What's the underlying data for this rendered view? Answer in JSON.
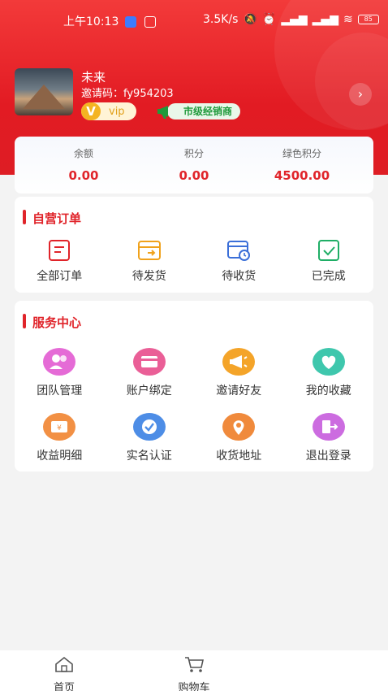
{
  "status_bar": {
    "time": "上午10:13",
    "network_speed": "3.5K/s",
    "battery": "85"
  },
  "profile": {
    "username": "未来",
    "invite_code": "邀请码：fy954203",
    "vip_label": "vip",
    "vip_letter": "V",
    "dealer_label": "市级经销商"
  },
  "balance": {
    "items": [
      {
        "label": "余额",
        "value": "0.00"
      },
      {
        "label": "积分",
        "value": "0.00"
      },
      {
        "label": "绿色积分",
        "value": "4500.00"
      }
    ]
  },
  "orders": {
    "title": "自营订单",
    "items": [
      {
        "label": "全部订单",
        "icon": "order-list-icon",
        "color": "#e0242a"
      },
      {
        "label": "待发货",
        "icon": "ship-pending-icon",
        "color": "#f0a21c"
      },
      {
        "label": "待收货",
        "icon": "receive-pending-icon",
        "color": "#3b6fd8"
      },
      {
        "label": "已完成",
        "icon": "completed-icon",
        "color": "#1fae66"
      }
    ]
  },
  "services": {
    "title": "服务中心",
    "items": [
      {
        "label": "团队管理",
        "icon": "team-icon",
        "color": "#e56bd6"
      },
      {
        "label": "账户绑定",
        "icon": "card-icon",
        "color": "#ea5f97"
      },
      {
        "label": "邀请好友",
        "icon": "megaphone-icon",
        "color": "#f4a429"
      },
      {
        "label": "我的收藏",
        "icon": "heart-icon",
        "color": "#3fc7ad"
      },
      {
        "label": "收益明细",
        "icon": "ticket-icon",
        "color": "#f29044"
      },
      {
        "label": "实名认证",
        "icon": "verified-icon",
        "color": "#4d8de6"
      },
      {
        "label": "收货地址",
        "icon": "location-icon",
        "color": "#f08a3c"
      },
      {
        "label": "退出登录",
        "icon": "logout-icon",
        "color": "#cc6ce0"
      }
    ]
  },
  "tabbar": {
    "items": [
      {
        "label": "首页",
        "icon": "home-icon"
      },
      {
        "label": "购物车",
        "icon": "cart-icon"
      }
    ]
  }
}
